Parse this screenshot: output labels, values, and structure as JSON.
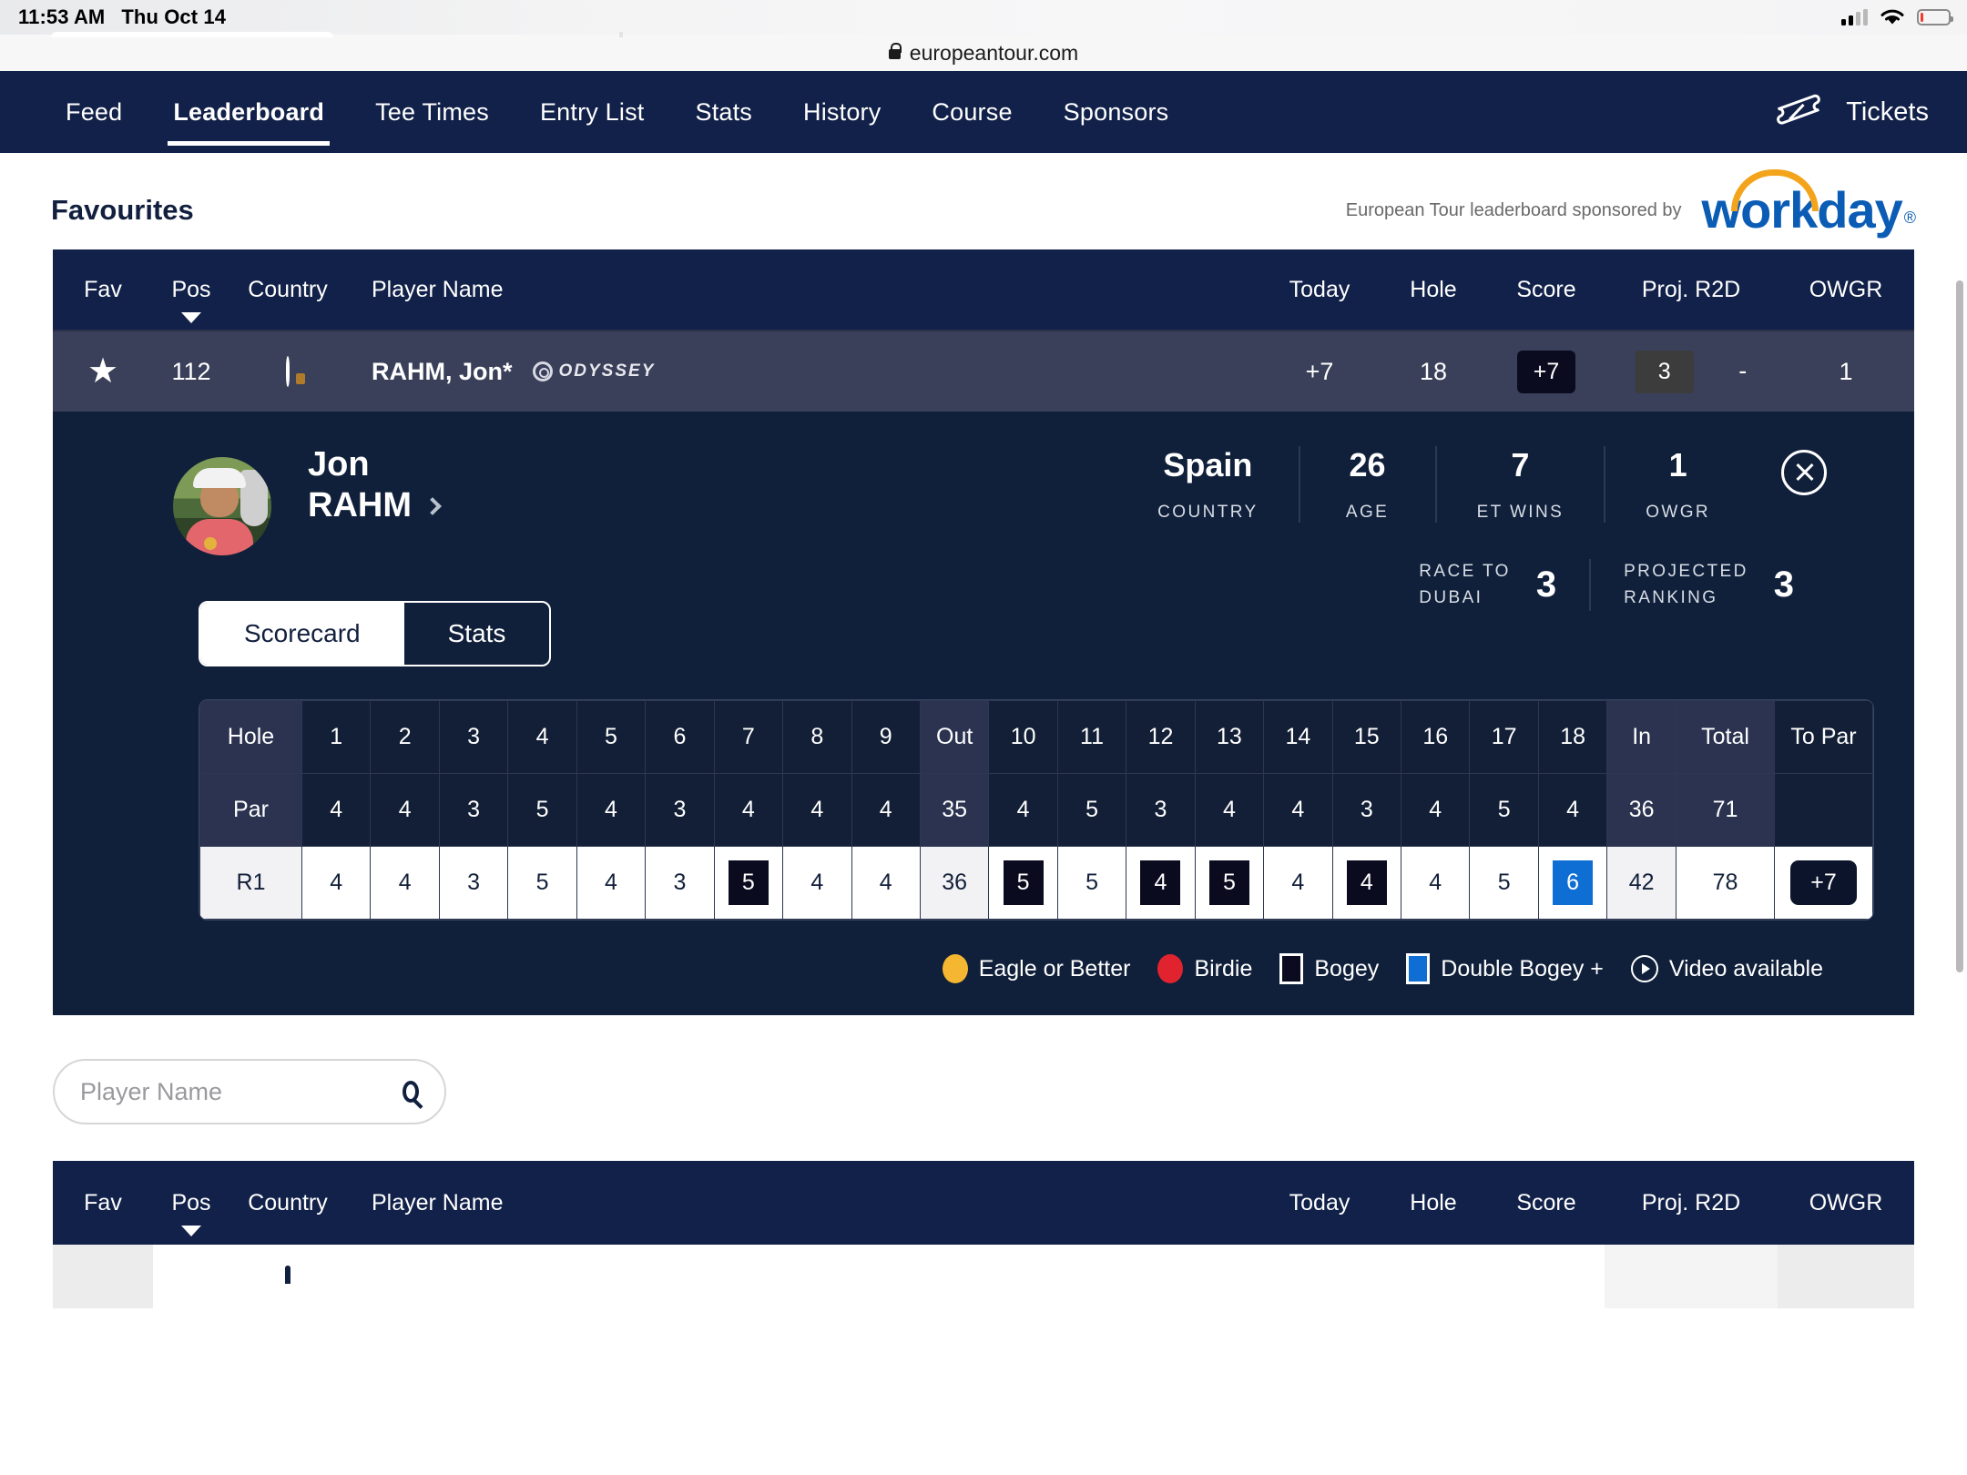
{
  "status_bar": {
    "time": "11:53 AM",
    "date": "Thu Oct 14"
  },
  "browser": {
    "url": "europeantour.com",
    "lock_icon": "lock-icon"
  },
  "nav": {
    "items": [
      {
        "label": "Feed",
        "active": false
      },
      {
        "label": "Leaderboard",
        "active": true
      },
      {
        "label": "Tee Times",
        "active": false
      },
      {
        "label": "Entry List",
        "active": false
      },
      {
        "label": "Stats",
        "active": false
      },
      {
        "label": "History",
        "active": false
      },
      {
        "label": "Course",
        "active": false
      },
      {
        "label": "Sponsors",
        "active": false
      }
    ],
    "tickets_label": "Tickets",
    "tickets_icon": "ticket-icon"
  },
  "section": {
    "title": "Favourites",
    "sponsor_text": "European Tour leaderboard sponsored by",
    "sponsor_brand": "workday",
    "sponsor_trademark": "®"
  },
  "leaderboard": {
    "columns": {
      "fav": "Fav",
      "pos": "Pos",
      "country": "Country",
      "player_name": "Player Name",
      "today": "Today",
      "hole": "Hole",
      "score": "Score",
      "proj_r2d": "Proj. R2D",
      "owgr": "OWGR"
    },
    "row": {
      "fav_icon": "star-filled-icon",
      "fav_star": "★",
      "pos": "112",
      "country_flag": "spain-flag",
      "name": "RAHM, Jon*",
      "sponsor_logo": "ODYSSEY",
      "today": "+7",
      "hole": "18",
      "score": "+7",
      "proj_r2d": "3",
      "r2d_dash": "-",
      "owgr": "1"
    }
  },
  "player_panel": {
    "avatar_icon": "player-photo",
    "first_name": "Jon",
    "last_name": "RAHM",
    "chevron_icon": "chevron-right-icon",
    "close_icon": "close-circle-icon",
    "stats": [
      {
        "value": "Spain",
        "label": "COUNTRY"
      },
      {
        "value": "26",
        "label": "AGE"
      },
      {
        "value": "7",
        "label": "ET WINS"
      },
      {
        "value": "1",
        "label": "OWGR"
      }
    ],
    "rankings": [
      {
        "label_line1": "RACE TO",
        "label_line2": "DUBAI",
        "value": "3"
      },
      {
        "label_line1": "PROJECTED",
        "label_line2": "RANKING",
        "value": "3"
      }
    ],
    "tabs": {
      "scorecard": "Scorecard",
      "stats": "Stats",
      "active": "Scorecard"
    }
  },
  "scorecard": {
    "row_labels": {
      "hole": "Hole",
      "par": "Par",
      "round": "R1"
    },
    "headers": [
      "1",
      "2",
      "3",
      "4",
      "5",
      "6",
      "7",
      "8",
      "9",
      "Out",
      "10",
      "11",
      "12",
      "13",
      "14",
      "15",
      "16",
      "17",
      "18",
      "In",
      "Total",
      "To Par"
    ],
    "par": [
      "4",
      "4",
      "3",
      "5",
      "4",
      "3",
      "4",
      "4",
      "4",
      "35",
      "4",
      "5",
      "3",
      "4",
      "4",
      "3",
      "4",
      "5",
      "4",
      "36",
      "71",
      ""
    ],
    "r1": [
      "4",
      "4",
      "3",
      "5",
      "4",
      "3",
      "5",
      "4",
      "4",
      "36",
      "5",
      "5",
      "4",
      "5",
      "4",
      "4",
      "4",
      "5",
      "6",
      "42",
      "78",
      "+7"
    ],
    "r1_marks": [
      "",
      "",
      "",
      "",
      "",
      "",
      "bogey",
      "",
      "",
      "sum",
      "bogey",
      "",
      "bogey",
      "bogey",
      "",
      "bogey",
      "",
      "",
      "dbl",
      "sum",
      "",
      "topar"
    ],
    "legend": [
      {
        "icon": "eagle-circle-gold",
        "label": "Eagle or Better"
      },
      {
        "icon": "birdie-circle-red",
        "label": "Birdie"
      },
      {
        "icon": "bogey-square-dark",
        "label": "Bogey"
      },
      {
        "icon": "double-bogey-square-blue",
        "label": "Double Bogey +"
      },
      {
        "icon": "video-play-icon",
        "label": "Video available"
      }
    ]
  },
  "search": {
    "placeholder": "Player Name",
    "value": "",
    "icon": "search-icon"
  },
  "colors": {
    "navy": "#122149",
    "panel_navy": "#10203a",
    "row_grey": "#3a405a",
    "accent_blue": "#0f6ed4",
    "gold": "#f5b731",
    "red": "#e0232e",
    "workday_blue": "#0b5cb5",
    "workday_orange": "#f3a41b"
  }
}
